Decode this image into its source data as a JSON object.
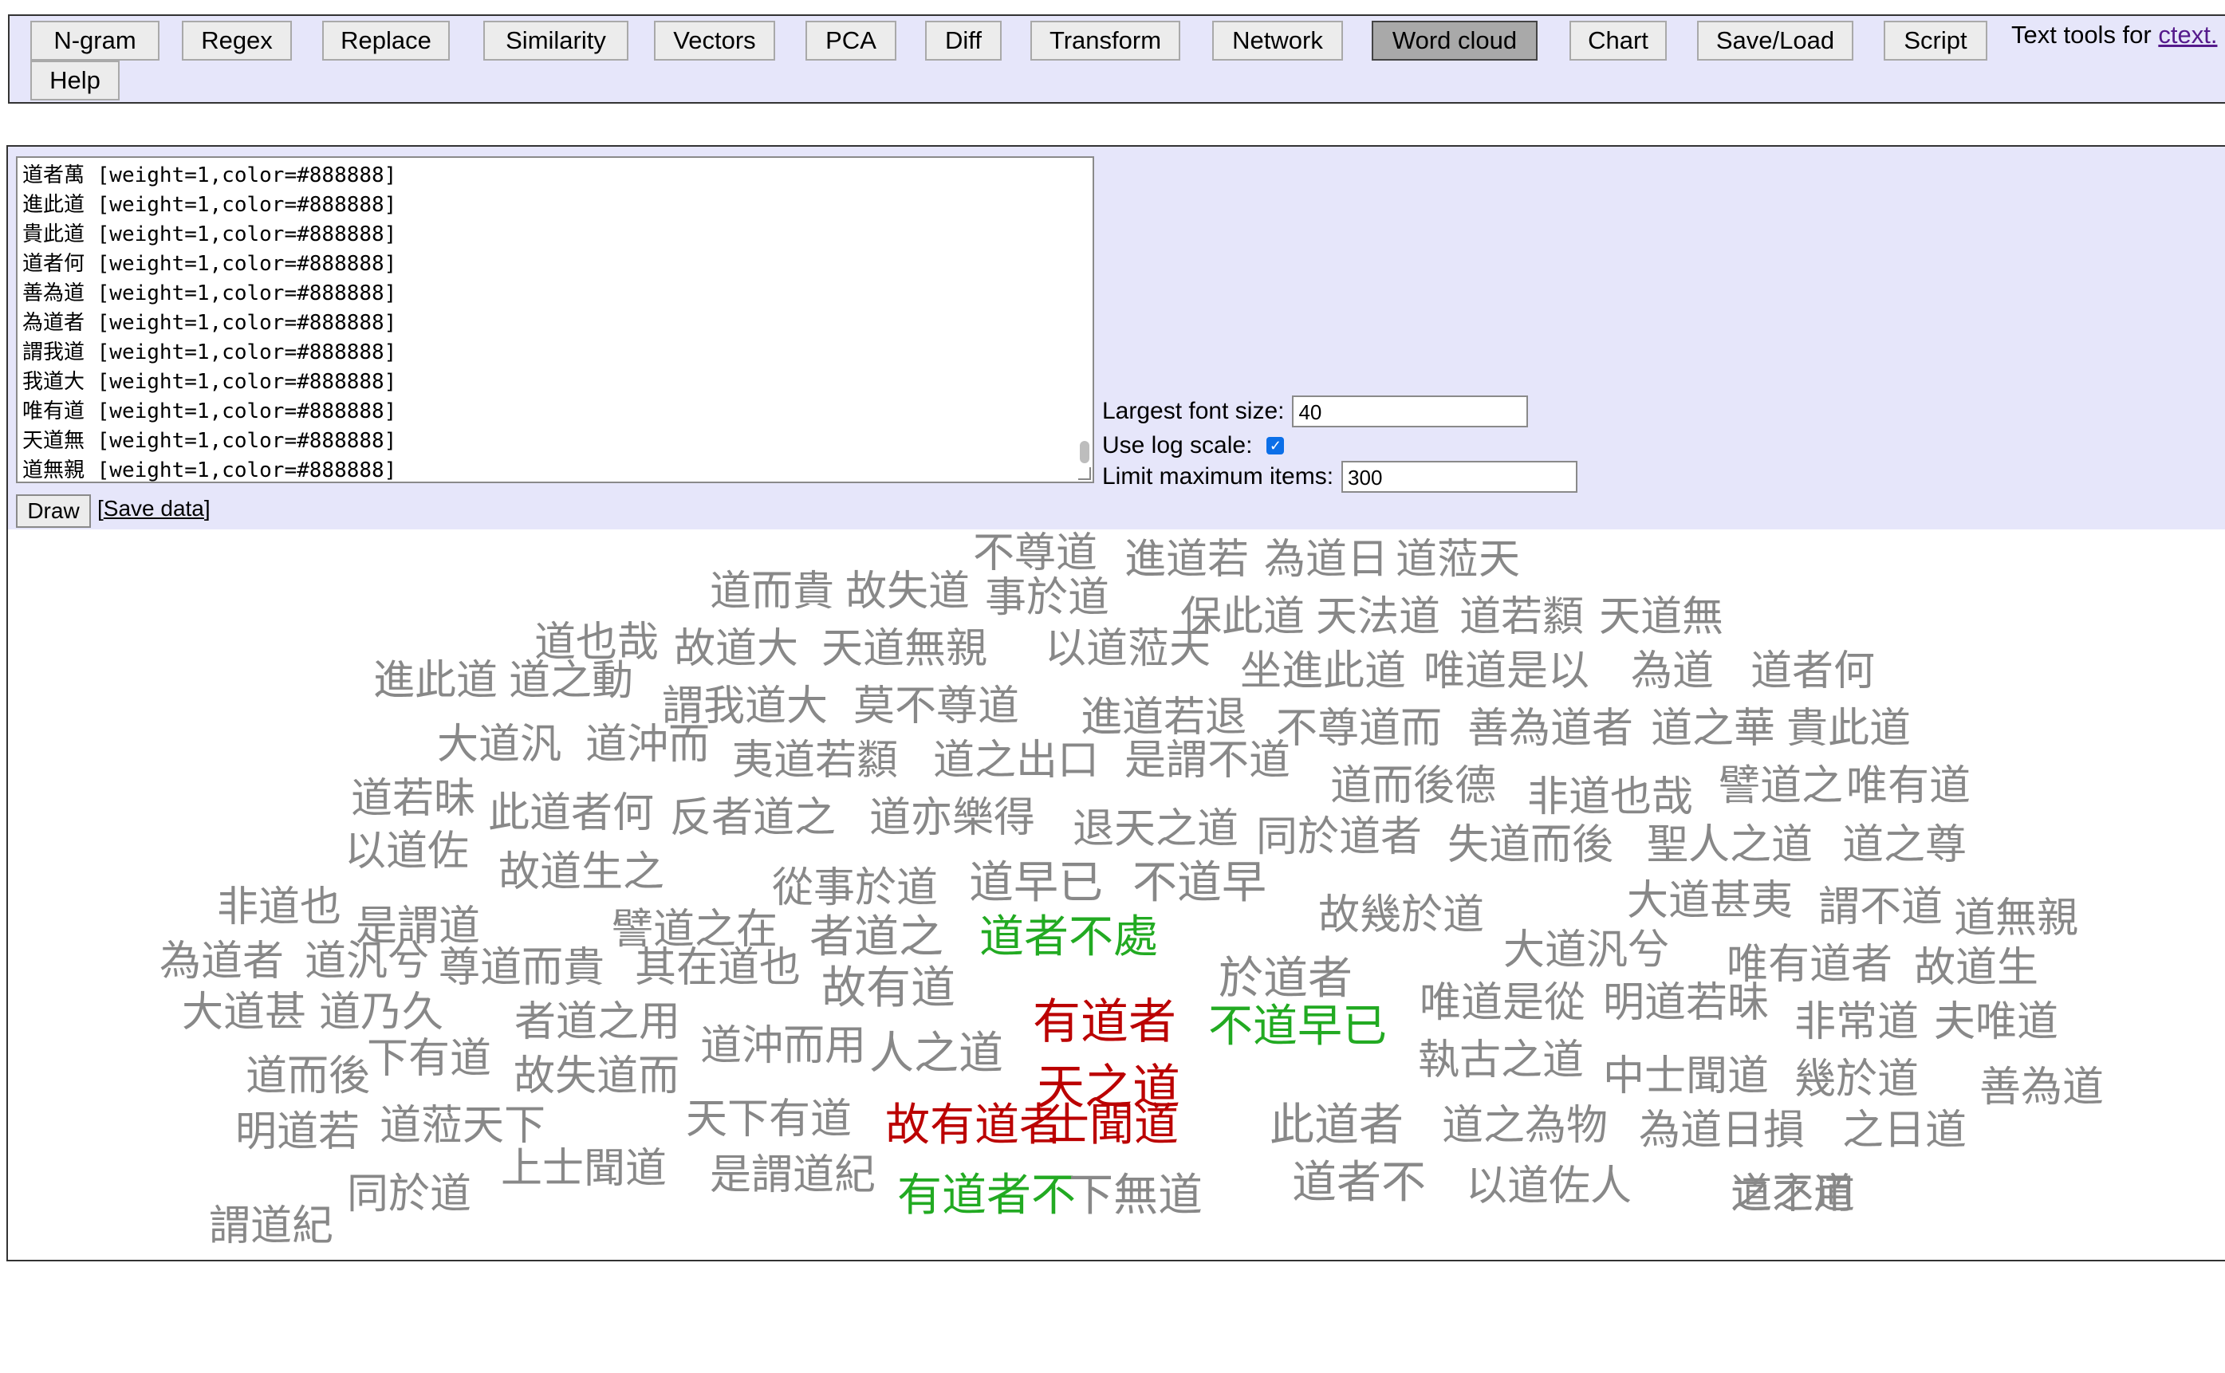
{
  "toolbar": {
    "buttons": [
      {
        "label": "N-gram",
        "active": false
      },
      {
        "label": "Regex",
        "active": false
      },
      {
        "label": "Replace",
        "active": false
      },
      {
        "label": "Similarity",
        "active": false
      },
      {
        "label": "Vectors",
        "active": false
      },
      {
        "label": "PCA",
        "active": false
      },
      {
        "label": "Diff",
        "active": false
      },
      {
        "label": "Transform",
        "active": false
      },
      {
        "label": "Network",
        "active": false
      },
      {
        "label": "Word cloud",
        "active": true
      },
      {
        "label": "Chart",
        "active": false
      },
      {
        "label": "Save/Load",
        "active": false
      },
      {
        "label": "Script",
        "active": false
      },
      {
        "label": "Help",
        "active": false
      }
    ],
    "note_text": "Text tools for ",
    "note_link": "ctext.",
    "active_color": "#a9a9a9",
    "bar_color": "#e6e6fa"
  },
  "editor": {
    "lines": [
      "道者萬 [weight=1,color=#888888]",
      "進此道 [weight=1,color=#888888]",
      "貴此道 [weight=1,color=#888888]",
      "道者何 [weight=1,color=#888888]",
      "善為道 [weight=1,color=#888888]",
      "為道者 [weight=1,color=#888888]",
      "謂我道 [weight=1,color=#888888]",
      "我道大 [weight=1,color=#888888]",
      "唯有道 [weight=1,color=#888888]",
      "天道無 [weight=1,color=#888888]",
      "道無親 [weight=1,color=#888888]"
    ]
  },
  "options": {
    "largest_font_label": "Largest font size:",
    "largest_font_value": "40",
    "log_scale_label": "Use log scale:",
    "log_scale_checked": true,
    "limit_label": "Limit maximum items:",
    "limit_value": "300"
  },
  "actions": {
    "draw_label": "Draw",
    "save_data_open": "[",
    "save_data_label": "Save data",
    "save_data_close": "]"
  },
  "colors": {
    "gray": "#888888",
    "green": "#22aa22",
    "red": "#bb0000"
  },
  "cloud_words": [
    {
      "t": "不尊道",
      "c": "gray",
      "w": 1
    },
    {
      "t": "進道若",
      "c": "gray",
      "w": 1
    },
    {
      "t": "為道日",
      "c": "gray",
      "w": 1
    },
    {
      "t": "道蒞天",
      "c": "gray",
      "w": 1
    },
    {
      "t": "道而貴",
      "c": "gray",
      "w": 1
    },
    {
      "t": "故失道",
      "c": "gray",
      "w": 1
    },
    {
      "t": "事於道",
      "c": "gray",
      "w": 1
    },
    {
      "t": "保此道",
      "c": "gray",
      "w": 1
    },
    {
      "t": "天法道",
      "c": "gray",
      "w": 1
    },
    {
      "t": "道若纇",
      "c": "gray",
      "w": 1
    },
    {
      "t": "天道無",
      "c": "gray",
      "w": 1
    },
    {
      "t": "道也哉",
      "c": "gray",
      "w": 1
    },
    {
      "t": "故道大",
      "c": "gray",
      "w": 1
    },
    {
      "t": "天道無親",
      "c": "gray",
      "w": 1
    },
    {
      "t": "以道蒞天",
      "c": "gray",
      "w": 1
    },
    {
      "t": "進此道",
      "c": "gray",
      "w": 1
    },
    {
      "t": "道之動",
      "c": "gray",
      "w": 1
    },
    {
      "t": "謂我道大",
      "c": "gray",
      "w": 1
    },
    {
      "t": "莫不尊道",
      "c": "gray",
      "w": 1
    },
    {
      "t": "坐進此道",
      "c": "gray",
      "w": 1
    },
    {
      "t": "唯道是以",
      "c": "gray",
      "w": 1
    },
    {
      "t": "為道",
      "c": "gray",
      "w": 1
    },
    {
      "t": "道者何",
      "c": "gray",
      "w": 1
    },
    {
      "t": "進道若退",
      "c": "gray",
      "w": 1
    },
    {
      "t": "不尊道而",
      "c": "gray",
      "w": 1
    },
    {
      "t": "善為道者",
      "c": "gray",
      "w": 1
    },
    {
      "t": "道之華",
      "c": "gray",
      "w": 1
    },
    {
      "t": "貴此道",
      "c": "gray",
      "w": 1
    },
    {
      "t": "大道汎",
      "c": "gray",
      "w": 1
    },
    {
      "t": "道沖而",
      "c": "gray",
      "w": 1
    },
    {
      "t": "夷道若纇",
      "c": "gray",
      "w": 1
    },
    {
      "t": "道之出口",
      "c": "gray",
      "w": 1
    },
    {
      "t": "是謂不道",
      "c": "gray",
      "w": 1
    },
    {
      "t": "道而後德",
      "c": "gray",
      "w": 1
    },
    {
      "t": "非道也哉",
      "c": "gray",
      "w": 1
    },
    {
      "t": "譬道之",
      "c": "gray",
      "w": 1
    },
    {
      "t": "唯有道",
      "c": "gray",
      "w": 1
    },
    {
      "t": "道若昧",
      "c": "gray",
      "w": 1
    },
    {
      "t": "此道者何",
      "c": "gray",
      "w": 1
    },
    {
      "t": "反者道之",
      "c": "gray",
      "w": 1
    },
    {
      "t": "道亦樂得",
      "c": "gray",
      "w": 1
    },
    {
      "t": "退天之道",
      "c": "gray",
      "w": 1
    },
    {
      "t": "同於道者",
      "c": "gray",
      "w": 1
    },
    {
      "t": "失道而後",
      "c": "gray",
      "w": 1
    },
    {
      "t": "聖人之道",
      "c": "gray",
      "w": 1
    },
    {
      "t": "道之尊",
      "c": "gray",
      "w": 1
    },
    {
      "t": "以道佐",
      "c": "gray",
      "w": 1
    },
    {
      "t": "故道生之",
      "c": "gray",
      "w": 1
    },
    {
      "t": "從事於道",
      "c": "gray",
      "w": 1
    },
    {
      "t": "道早已",
      "c": "gray",
      "w": 1.1
    },
    {
      "t": "不道早",
      "c": "gray",
      "w": 1.1
    },
    {
      "t": "非道也",
      "c": "gray",
      "w": 1
    },
    {
      "t": "是謂道",
      "c": "gray",
      "w": 1
    },
    {
      "t": "譬道之在",
      "c": "gray",
      "w": 1
    },
    {
      "t": "者道之",
      "c": "gray",
      "w": 1.1
    },
    {
      "t": "道者不處",
      "c": "green",
      "w": 1.1
    },
    {
      "t": "故幾於道",
      "c": "gray",
      "w": 1
    },
    {
      "t": "大道甚夷",
      "c": "gray",
      "w": 1
    },
    {
      "t": "謂不道",
      "c": "gray",
      "w": 1
    },
    {
      "t": "道無親",
      "c": "gray",
      "w": 1
    },
    {
      "t": "為道者",
      "c": "gray",
      "w": 1
    },
    {
      "t": "道汎兮",
      "c": "gray",
      "w": 1
    },
    {
      "t": "尊道而貴",
      "c": "gray",
      "w": 1
    },
    {
      "t": "其在道也",
      "c": "gray",
      "w": 1
    },
    {
      "t": "故有道",
      "c": "gray",
      "w": 1.1
    },
    {
      "t": "於道者",
      "c": "gray",
      "w": 1.1
    },
    {
      "t": "大道汎兮",
      "c": "gray",
      "w": 1
    },
    {
      "t": "唯有道者",
      "c": "gray",
      "w": 1
    },
    {
      "t": "故道生",
      "c": "gray",
      "w": 1
    },
    {
      "t": "大道甚",
      "c": "gray",
      "w": 1
    },
    {
      "t": "道乃久",
      "c": "gray",
      "w": 1
    },
    {
      "t": "者道之用",
      "c": "gray",
      "w": 1
    },
    {
      "t": "有道者",
      "c": "red",
      "w": 1.3
    },
    {
      "t": "不道早已",
      "c": "green",
      "w": 1.1
    },
    {
      "t": "唯道是從",
      "c": "gray",
      "w": 1
    },
    {
      "t": "明道若昧",
      "c": "gray",
      "w": 1
    },
    {
      "t": "非常道",
      "c": "gray",
      "w": 1
    },
    {
      "t": "夫唯道",
      "c": "gray",
      "w": 1
    },
    {
      "t": "下有道",
      "c": "gray",
      "w": 1
    },
    {
      "t": "道沖而用",
      "c": "gray",
      "w": 1
    },
    {
      "t": "人之道",
      "c": "gray",
      "w": 1.1
    },
    {
      "t": "道而後",
      "c": "gray",
      "w": 1
    },
    {
      "t": "故失道而",
      "c": "gray",
      "w": 1
    },
    {
      "t": "天之道",
      "c": "red",
      "w": 1.3
    },
    {
      "t": "執古之道",
      "c": "gray",
      "w": 1
    },
    {
      "t": "中士聞道",
      "c": "gray",
      "w": 1
    },
    {
      "t": "幾於道",
      "c": "gray",
      "w": 1
    },
    {
      "t": "善為道",
      "c": "gray",
      "w": 1
    },
    {
      "t": "此道者",
      "c": "gray",
      "w": 1.1
    },
    {
      "t": "天下有道",
      "c": "gray",
      "w": 1
    },
    {
      "t": "故有道者",
      "c": "red",
      "w": 1.15
    },
    {
      "t": "士聞道",
      "c": "red",
      "w": 1.15
    },
    {
      "t": "明道若",
      "c": "gray",
      "w": 1
    },
    {
      "t": "道蒞天下",
      "c": "gray",
      "w": 1
    },
    {
      "t": "道之為物",
      "c": "gray",
      "w": 1
    },
    {
      "t": "為道日損",
      "c": "gray",
      "w": 1
    },
    {
      "t": "之日道",
      "c": "gray",
      "w": 1
    },
    {
      "t": "上士聞道",
      "c": "gray",
      "w": 1
    },
    {
      "t": "是謂道紀",
      "c": "gray",
      "w": 1
    },
    {
      "t": "道者不",
      "c": "gray",
      "w": 1.1
    },
    {
      "t": "以道佐人",
      "c": "gray",
      "w": 1
    },
    {
      "t": "之不道",
      "c": "gray",
      "w": 1
    },
    {
      "t": "謂道紀",
      "c": "gray",
      "w": 1
    },
    {
      "t": "同於道",
      "c": "gray",
      "w": 1.1
    },
    {
      "t": "有道者不",
      "c": "green",
      "w": 1.1
    },
    {
      "t": "下無道",
      "c": "gray",
      "w": 1
    },
    {
      "t": "道之用",
      "c": "gray",
      "w": 1
    }
  ]
}
